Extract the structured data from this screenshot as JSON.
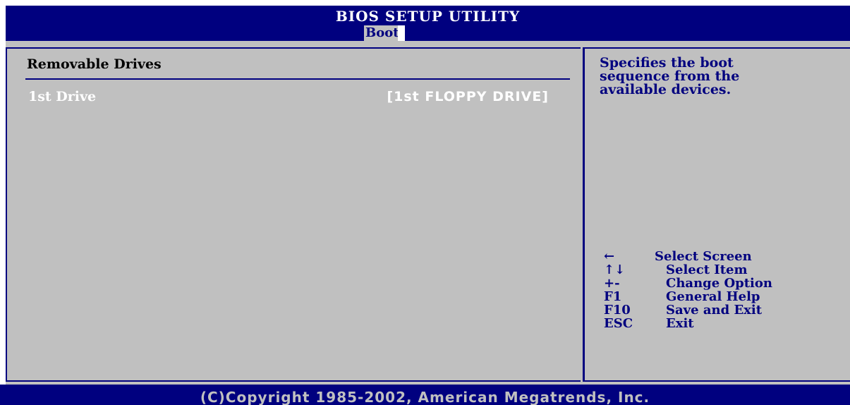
{
  "header": {
    "title": "BIOS SETUP UTILITY",
    "active_tab": "Boot"
  },
  "main": {
    "section_title": "Removable Drives",
    "items": [
      {
        "label": "1st Drive",
        "value": "[1st FLOPPY DRIVE]"
      }
    ]
  },
  "help": {
    "lines": [
      "Specifies the boot",
      "sequence from the",
      "available devices."
    ]
  },
  "keys": [
    {
      "key": "←",
      "desc": "Select Screen"
    },
    {
      "key": "↑↓",
      "desc": "Select Item"
    },
    {
      "key": "+-",
      "desc": "Change Option"
    },
    {
      "key": "F1",
      "desc": "General Help"
    },
    {
      "key": "F10",
      "desc": "Save and Exit"
    },
    {
      "key": "ESC",
      "desc": "Exit"
    }
  ],
  "footer": {
    "copyright": "(C)Copyright 1985-2002, American Megatrends, Inc."
  },
  "colors": {
    "bios_blue": "#00007f",
    "panel_gray": "#c0c0c0",
    "text_white": "#ffffff"
  }
}
